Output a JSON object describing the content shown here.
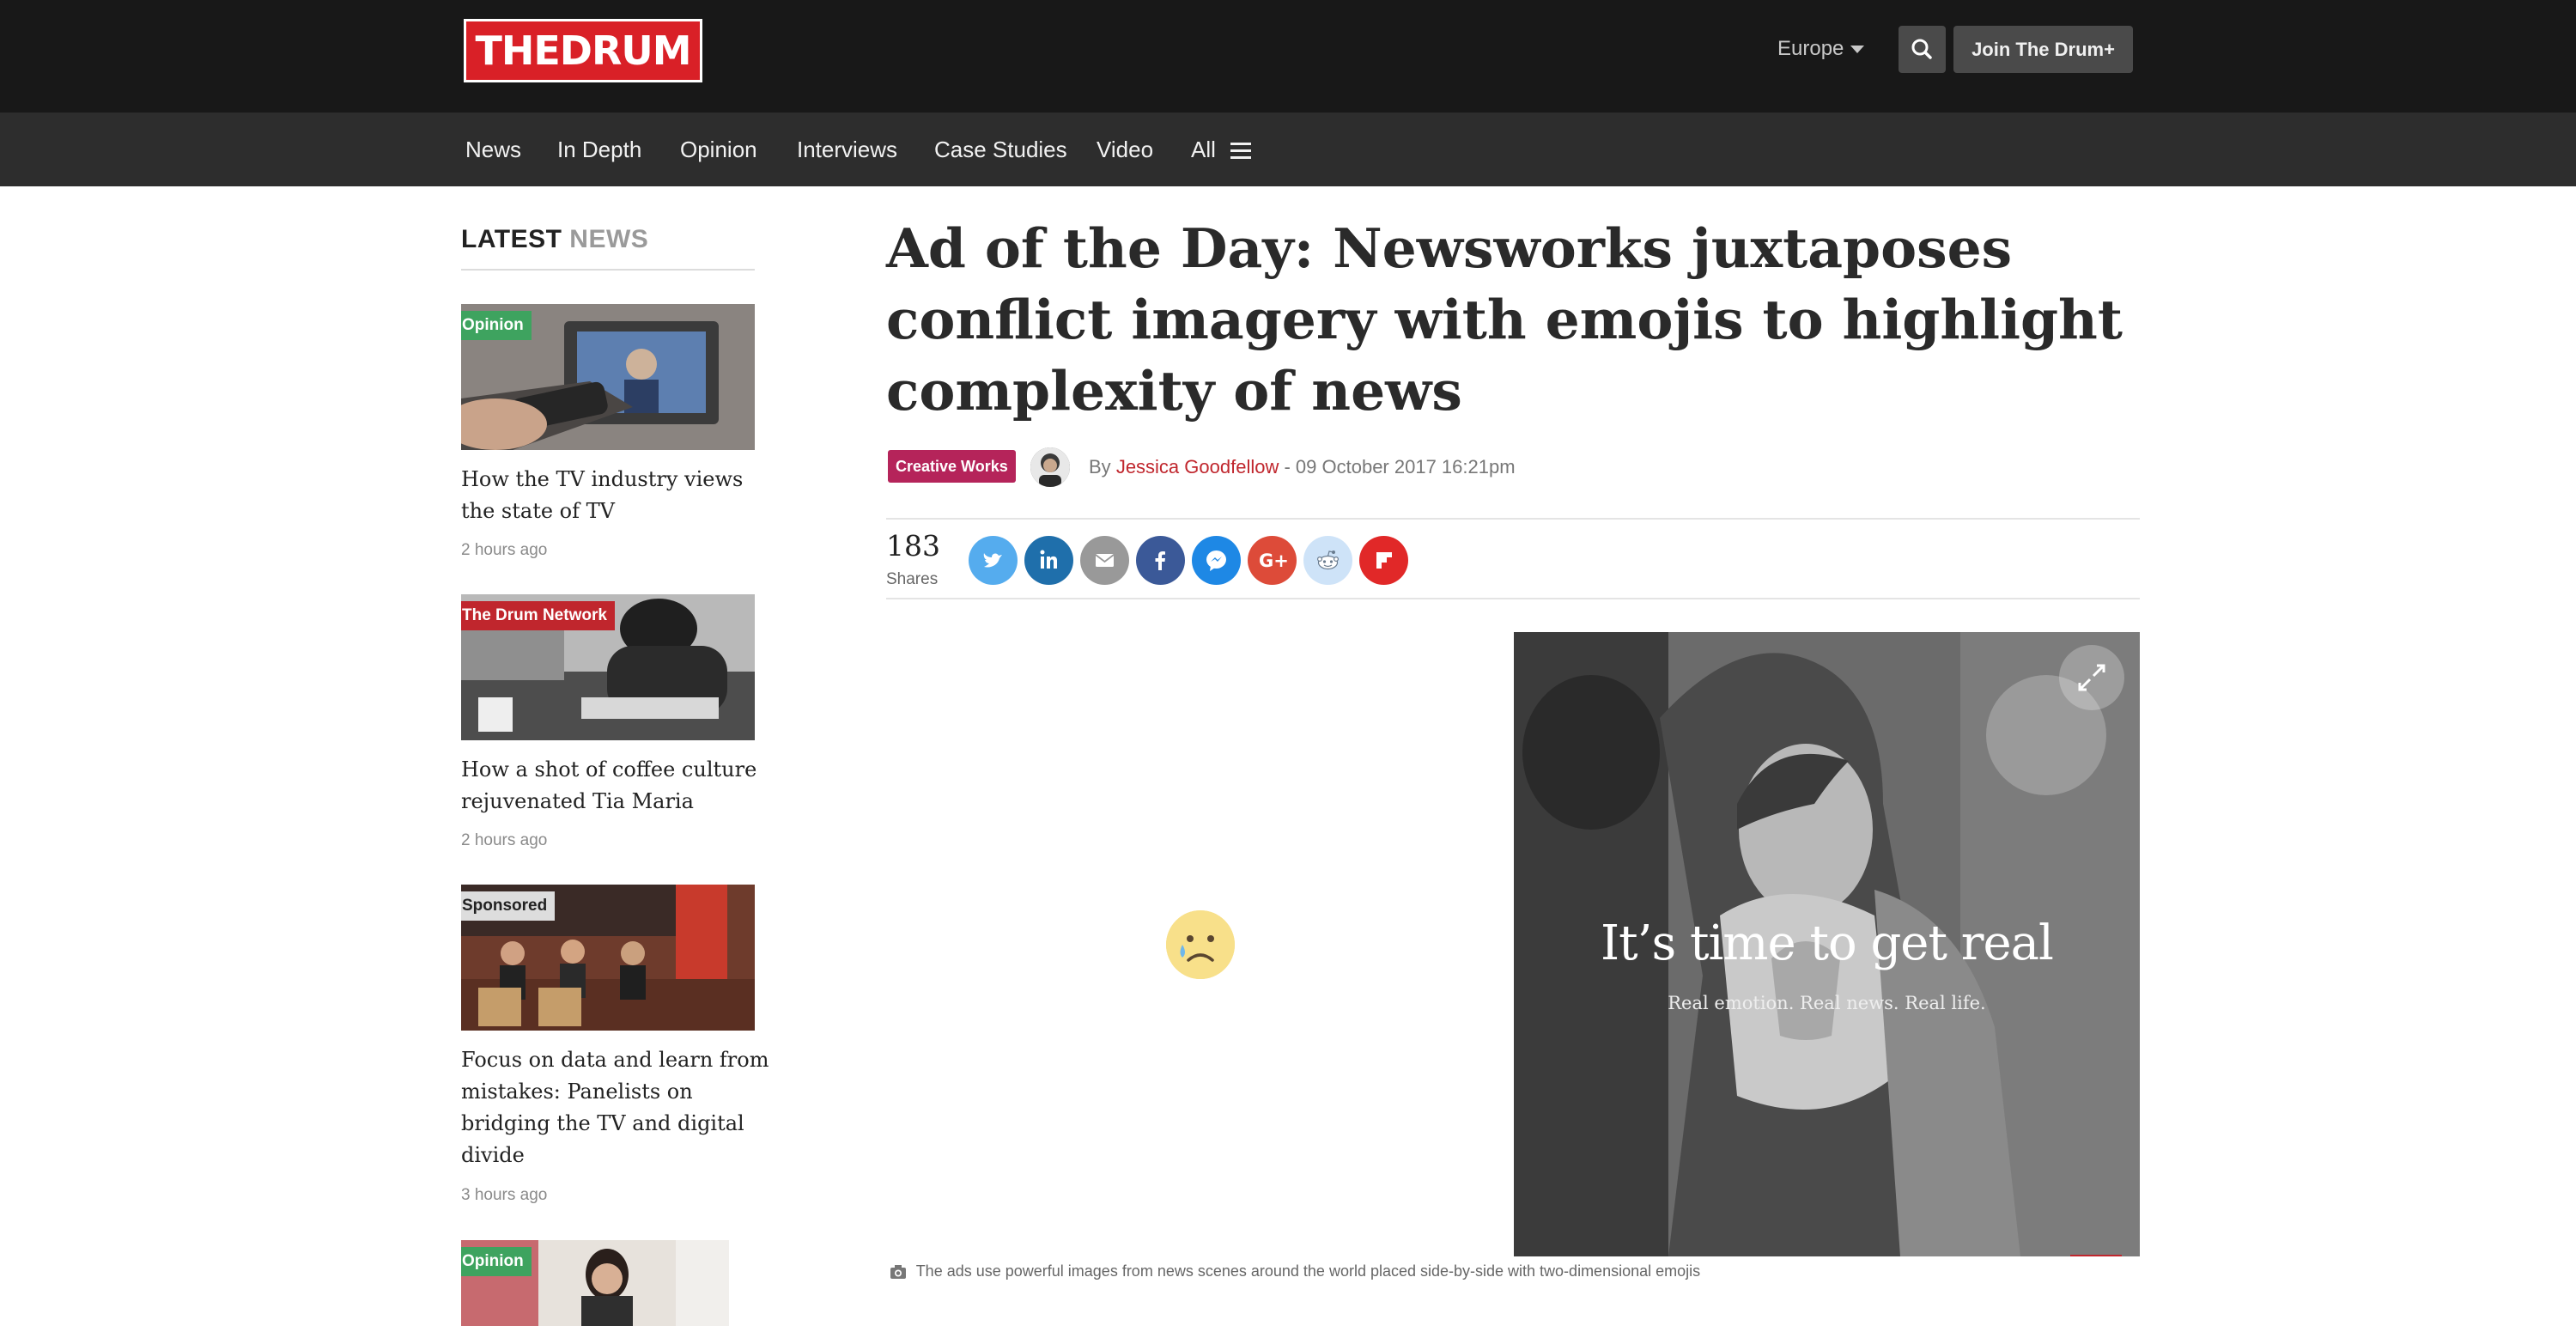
{
  "header": {
    "logo_text": "THEDRUM",
    "region": "Europe",
    "join_label": "Join The Drum+"
  },
  "nav": {
    "items": [
      "News",
      "In Depth",
      "Opinion",
      "Interviews",
      "Case Studies",
      "Video",
      "All"
    ]
  },
  "sidebar": {
    "title_a": "LATEST",
    "title_b": "NEWS",
    "cards": [
      {
        "badge": "Opinion",
        "badge_color": "#3ea35f",
        "title": "How the TV industry views the state of TV",
        "time": "2 hours ago"
      },
      {
        "badge": "The Drum Network",
        "badge_color": "#c0262d",
        "title": "How a shot of coffee culture rejuvenated Tia Maria",
        "time": "2 hours ago"
      },
      {
        "badge": "Sponsored",
        "badge_color": "#dddddd",
        "title": "Focus on data and learn from mistakes: Panelists on bridging the TV and digital divide",
        "time": "3 hours ago"
      },
      {
        "badge": "Opinion",
        "badge_color": "#3ea35f",
        "title": "",
        "time": ""
      }
    ]
  },
  "article": {
    "headline": "Ad of the Day: Newsworks juxtaposes conflict imagery with emojis to highlight complexity of news",
    "tag": "Creative Works",
    "by": "By",
    "author": "Jessica Goodfellow",
    "date": "- 09 October 2017 16:21pm",
    "shares_count": "183",
    "shares_label": "Shares",
    "hero_title": "It’s time to get real",
    "hero_subtitle": "Real emotion. Real news. Real life.",
    "caption": "The ads use powerful images from news scenes around the world placed side-by-side with two-dimensional emojis"
  },
  "share_buttons": [
    {
      "name": "twitter",
      "icon": "twitter-icon",
      "color": "#55acee"
    },
    {
      "name": "linkedin",
      "icon": "linkedin-icon",
      "color": "#1f6fab"
    },
    {
      "name": "email",
      "icon": "email-icon",
      "color": "#999999"
    },
    {
      "name": "facebook",
      "icon": "facebook-icon",
      "color": "#3b5998"
    },
    {
      "name": "messenger",
      "icon": "messenger-icon",
      "color": "#1e88e5"
    },
    {
      "name": "googleplus",
      "icon": "google-plus-icon",
      "color": "#dd4b39"
    },
    {
      "name": "reddit",
      "icon": "reddit-icon",
      "color": "#cee3f8"
    },
    {
      "name": "flipboard",
      "icon": "flipboard-icon",
      "color": "#e12828"
    }
  ]
}
